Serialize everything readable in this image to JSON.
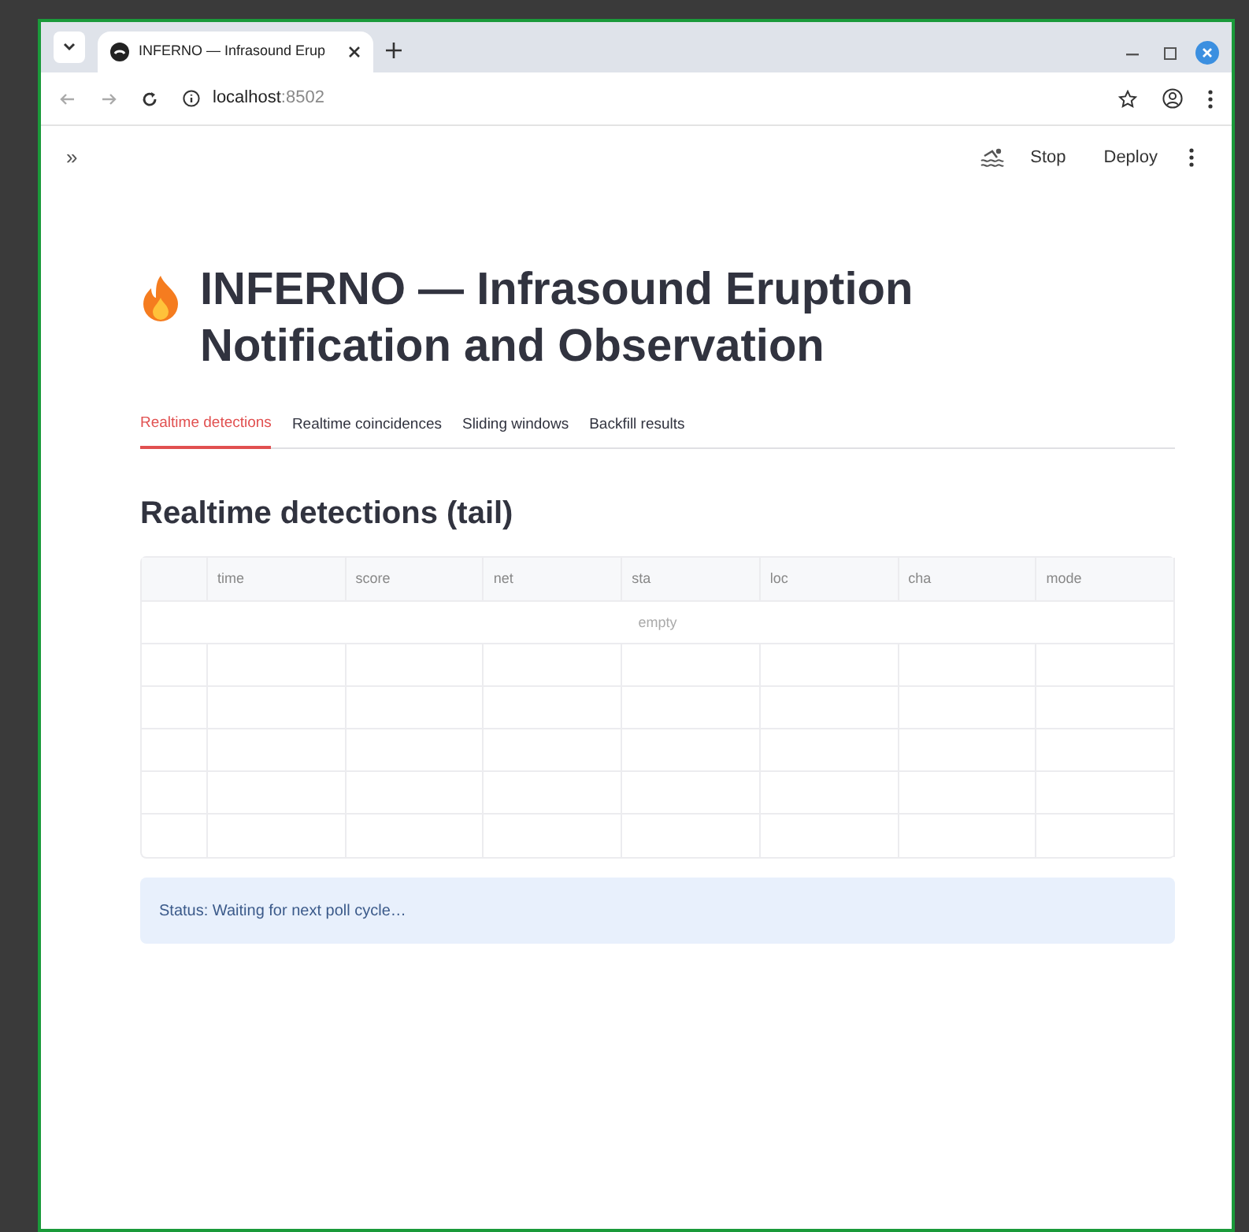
{
  "browser": {
    "tab_title": "INFERNO — Infrasound Erup",
    "url_host": "localhost",
    "url_port": ":8502"
  },
  "toolbar": {
    "expand": "»",
    "stop": "Stop",
    "deploy": "Deploy"
  },
  "title": "INFERNO — Infrasound Eruption Notification and Observation",
  "tabs": [
    {
      "label": "Realtime detections",
      "selected": true
    },
    {
      "label": "Realtime coincidences",
      "selected": false
    },
    {
      "label": "Sliding windows",
      "selected": false
    },
    {
      "label": "Backfill results",
      "selected": false
    }
  ],
  "section_heading": "Realtime detections (tail)",
  "table": {
    "columns": [
      "time",
      "score",
      "net",
      "sta",
      "loc",
      "cha",
      "mode"
    ],
    "empty_text": "empty"
  },
  "status": "Status: Waiting for next poll cycle…"
}
